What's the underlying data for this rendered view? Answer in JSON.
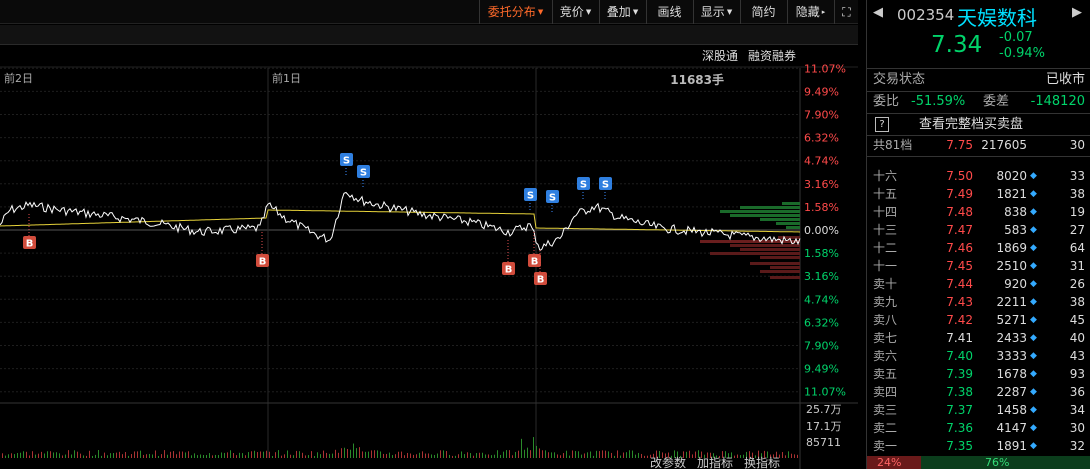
{
  "toolbar": {
    "items": [
      {
        "label": "委托分布",
        "arrow": "▼"
      },
      {
        "label": "竞价",
        "arrow": "▼"
      },
      {
        "label": "叠加",
        "arrow": "▼"
      },
      {
        "label": "画线",
        "arrow": ""
      },
      {
        "label": "显示",
        "arrow": "▼"
      },
      {
        "label": "简约",
        "arrow": ""
      },
      {
        "label": "隐藏",
        "arrow": "▸"
      },
      {
        "label": "⛶",
        "arrow": ""
      }
    ]
  },
  "chart_links": [
    "深股通",
    "融资融券"
  ],
  "chart": {
    "day_labels": [
      "前2日",
      "前1日"
    ],
    "volume_label": "11683手",
    "pct_axis_up": [
      "11.07%",
      "9.49%",
      "7.90%",
      "6.32%",
      "4.74%",
      "3.16%",
      "1.58%"
    ],
    "pct_axis_zero": "0.00%",
    "pct_axis_down": [
      "1.58%",
      "3.16%",
      "4.74%",
      "6.32%",
      "7.90%",
      "9.49%",
      "11.07%"
    ],
    "vol_axis": [
      "25.7万",
      "17.1万",
      "85711"
    ],
    "signal_sell": "S",
    "signal_buy": "B",
    "bottom_links": [
      "改参数",
      "加指标",
      "换指标"
    ]
  },
  "quote": {
    "nav_prev": "◀",
    "nav_next": "▶",
    "code": "002354",
    "name": "天娱数科",
    "price": "7.34",
    "change": "-0.07",
    "change_pct": "-0.94%",
    "status_label": "交易状态",
    "status_value": "已收市",
    "ratio_label": "委比",
    "ratio_value": "-51.59%",
    "diff_label": "委差",
    "diff_value": "-148120",
    "full_book_icon": "?",
    "full_book_text": "查看完整档买卖盘",
    "top": {
      "label": "共81档",
      "price": "7.75",
      "volume": "217605",
      "orders": "30"
    },
    "asks": [
      {
        "label": "十六",
        "price": "7.50",
        "volume": "8020",
        "orders": "33",
        "cls": "up"
      },
      {
        "label": "十五",
        "price": "7.49",
        "volume": "1821",
        "orders": "38",
        "cls": "up"
      },
      {
        "label": "十四",
        "price": "7.48",
        "volume": "838",
        "orders": "19",
        "cls": "up"
      },
      {
        "label": "十三",
        "price": "7.47",
        "volume": "583",
        "orders": "27",
        "cls": "up"
      },
      {
        "label": "十二",
        "price": "7.46",
        "volume": "1869",
        "orders": "64",
        "cls": "up"
      },
      {
        "label": "十一",
        "price": "7.45",
        "volume": "2510",
        "orders": "31",
        "cls": "up"
      },
      {
        "label": "卖十",
        "price": "7.44",
        "volume": "920",
        "orders": "26",
        "cls": "up"
      },
      {
        "label": "卖九",
        "price": "7.43",
        "volume": "2211",
        "orders": "38",
        "cls": "up"
      },
      {
        "label": "卖八",
        "price": "7.42",
        "volume": "5271",
        "orders": "45",
        "cls": "up"
      },
      {
        "label": "卖七",
        "price": "7.41",
        "volume": "2433",
        "orders": "40",
        "cls": "flat"
      },
      {
        "label": "卖六",
        "price": "7.40",
        "volume": "3333",
        "orders": "43",
        "cls": "down"
      },
      {
        "label": "卖五",
        "price": "7.39",
        "volume": "1678",
        "orders": "93",
        "cls": "down"
      },
      {
        "label": "卖四",
        "price": "7.38",
        "volume": "2287",
        "orders": "36",
        "cls": "down"
      },
      {
        "label": "卖三",
        "price": "7.37",
        "volume": "1458",
        "orders": "34",
        "cls": "down"
      },
      {
        "label": "卖二",
        "price": "7.36",
        "volume": "4147",
        "orders": "30",
        "cls": "down"
      },
      {
        "label": "卖一",
        "price": "7.35",
        "volume": "1891",
        "orders": "32",
        "cls": "down"
      }
    ],
    "diamond": "◆",
    "ratio_bar": {
      "sell_pct": "24%",
      "buy_pct": "76%"
    }
  },
  "colors": {
    "up": "#ff4a4a",
    "down": "#00d36a",
    "price_line": "#ffffff",
    "avg_line": "#e6d23a",
    "accent": "#ff6a2a",
    "name": "#00e0ff"
  }
}
